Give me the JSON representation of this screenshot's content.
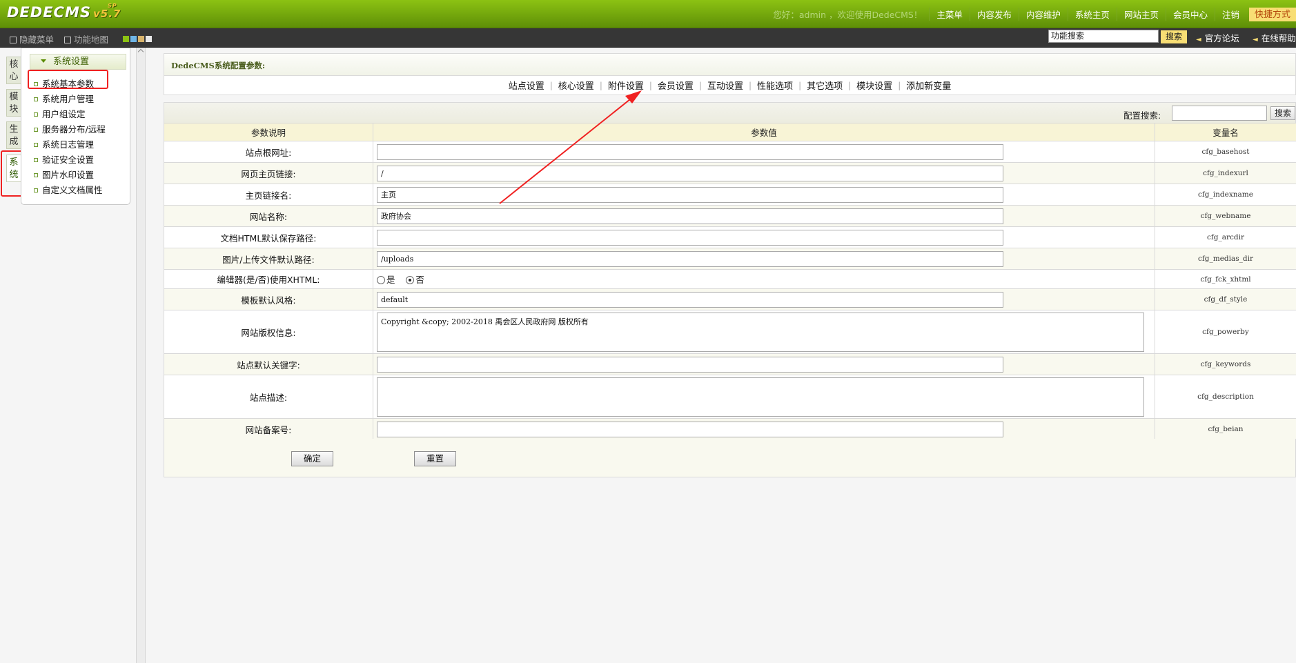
{
  "brand": {
    "logo": "DEDECMS",
    "version": "v5.7",
    "superscript": "SP"
  },
  "header": {
    "welcome": "您好：admin ，欢迎使用DedeCMS！",
    "nav": [
      "主菜单",
      "内容发布",
      "内容维护",
      "系统主页",
      "网站主页",
      "会员中心",
      "注销"
    ],
    "quick": "快捷方式"
  },
  "toolbar": {
    "hide_menu": "隐藏菜单",
    "function_map": "功能地图",
    "search_value": "功能搜索",
    "search_button": "搜索",
    "forum": "官方论坛",
    "help": "在线帮助"
  },
  "vtabs": [
    "核心",
    "模块",
    "生成",
    "系统"
  ],
  "menu": {
    "title": "系统设置",
    "items": [
      "系统基本参数",
      "系统用户管理",
      "用户组设定",
      "服务器分布/远程",
      "系统日志管理",
      "验证安全设置",
      "图片水印设置",
      "自定义文档属性"
    ]
  },
  "page": {
    "title": "DedeCMS系统配置参数:",
    "tabs": [
      "站点设置",
      "核心设置",
      "附件设置",
      "会员设置",
      "互动设置",
      "性能选项",
      "其它选项",
      "模块设置",
      "添加新变量"
    ],
    "search_label": "配置搜索:",
    "search_button": "搜索"
  },
  "table": {
    "headers": [
      "参数说明",
      "参数值",
      "变量名"
    ],
    "rows": [
      {
        "label": "站点根网址:",
        "value": "",
        "var": "cfg_basehost",
        "type": "input"
      },
      {
        "label": "网页主页链接:",
        "value": "/",
        "var": "cfg_indexurl",
        "type": "input"
      },
      {
        "label": "主页链接名:",
        "value": "主页",
        "var": "cfg_indexname",
        "type": "input"
      },
      {
        "label": "网站名称:",
        "value": "政府协会",
        "var": "cfg_webname",
        "type": "input"
      },
      {
        "label": "文档HTML默认保存路径:",
        "value": "",
        "var": "cfg_arcdir",
        "type": "input"
      },
      {
        "label": "图片/上传文件默认路径:",
        "value": "/uploads",
        "var": "cfg_medias_dir",
        "type": "input"
      },
      {
        "label": "编辑器(是/否)使用XHTML:",
        "value": "否",
        "options": [
          "是",
          "否"
        ],
        "var": "cfg_fck_xhtml",
        "type": "radio"
      },
      {
        "label": "模板默认风格:",
        "value": "default",
        "var": "cfg_df_style",
        "type": "input"
      },
      {
        "label": "网站版权信息:",
        "value": "Copyright &copy; 2002-2018 禹会区人民政府网 版权所有",
        "var": "cfg_powerby",
        "type": "textarea"
      },
      {
        "label": "站点默认关键字:",
        "value": "",
        "var": "cfg_keywords",
        "type": "input"
      },
      {
        "label": "站点描述:",
        "value": "",
        "var": "cfg_description",
        "type": "textarea"
      },
      {
        "label": "网站备案号:",
        "value": "",
        "var": "cfg_beian",
        "type": "input"
      }
    ]
  },
  "actions": {
    "confirm": "确定",
    "reset": "重置"
  },
  "colors": {
    "header_green": "#6b9e0c",
    "annotation_red": "#f02121",
    "accent_yellow": "#f8de74"
  }
}
